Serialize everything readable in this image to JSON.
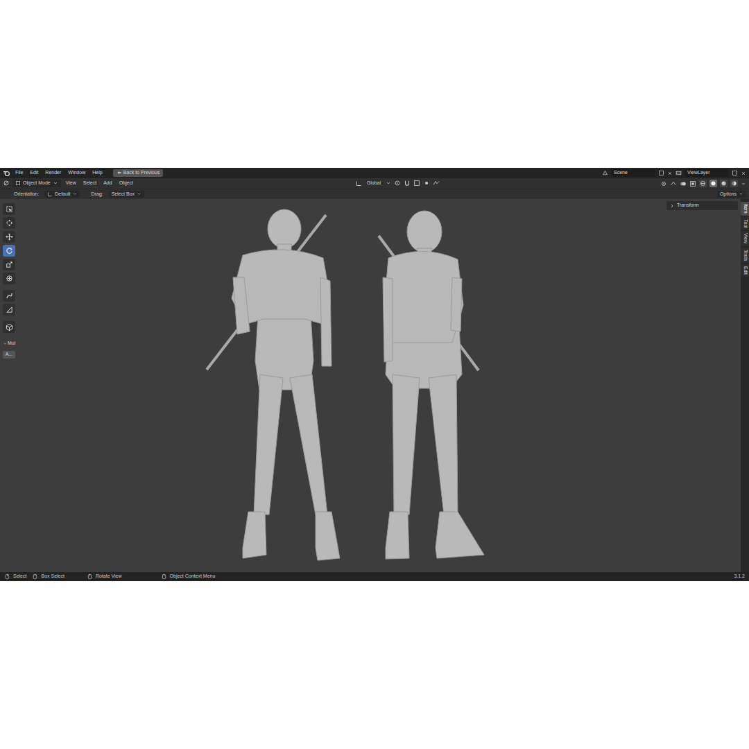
{
  "topbar": {
    "menus": [
      "File",
      "Edit",
      "Render",
      "Window",
      "Help"
    ],
    "back_button": "Back to Previous",
    "scene": "Scene",
    "view_layer": "ViewLayer"
  },
  "header": {
    "mode": "Object Mode",
    "menus": [
      "View",
      "Select",
      "Add",
      "Object"
    ],
    "orientation": "Global",
    "shading": [
      {
        "selected": false
      },
      {
        "selected": true
      },
      {
        "selected": false
      },
      {
        "selected": false
      }
    ]
  },
  "tool_settings": {
    "orientation_label": "Orientation:",
    "orientation_value": "Default",
    "drag_label": "Drag:",
    "drag_value": "Select Box",
    "options": "Options"
  },
  "toolbar": {
    "tools": [
      {
        "selected": false
      },
      {
        "selected": false
      },
      {
        "selected": false
      },
      {
        "selected": true
      },
      {
        "selected": false
      },
      {
        "selected": false
      },
      {
        "selected": false
      },
      {
        "selected": false
      },
      {
        "selected": false
      }
    ],
    "section_label": "Mul",
    "section_button": "A..."
  },
  "sidebar": {
    "panel": "Transform",
    "panel_expanded": false,
    "tabs": [
      {
        "label": "Item",
        "selected": true
      },
      {
        "label": "Tool",
        "selected": false
      },
      {
        "label": "View",
        "selected": false
      },
      {
        "label": "Tools",
        "selected": false
      },
      {
        "label": "Edit",
        "selected": false
      }
    ]
  },
  "status_bar": {
    "items": [
      "Select",
      "Box Select",
      "Rotate View",
      "Object Context Menu"
    ],
    "version": "3.1.2"
  }
}
